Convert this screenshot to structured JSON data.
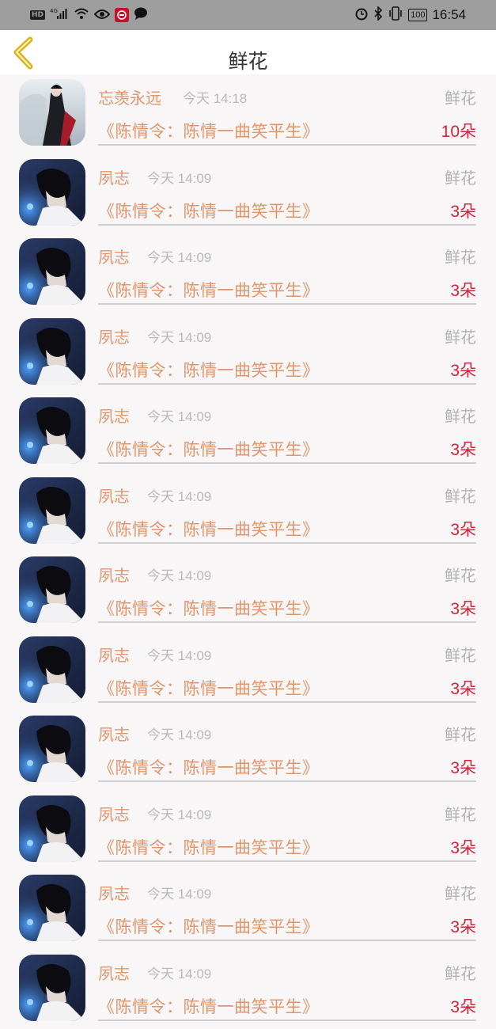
{
  "status_bar": {
    "hd": "HD",
    "signal": "4G",
    "battery": "100",
    "time": "16:54"
  },
  "header": {
    "title": "鲜花",
    "back_icon": "chevron-left-icon"
  },
  "colors": {
    "accent": "#e2956a",
    "count": "#d3223a",
    "muted": "#b9b9b9"
  },
  "records": [
    {
      "name": "忘羡永远",
      "time": "今天 14:18",
      "type": "鲜花",
      "work": "《陈情令：陈情一曲笑平生》",
      "count": "10朵"
    },
    {
      "name": "夙志",
      "time": "今天 14:09",
      "type": "鲜花",
      "work": "《陈情令：陈情一曲笑平生》",
      "count": "3朵"
    },
    {
      "name": "夙志",
      "time": "今天 14:09",
      "type": "鲜花",
      "work": "《陈情令：陈情一曲笑平生》",
      "count": "3朵"
    },
    {
      "name": "夙志",
      "time": "今天 14:09",
      "type": "鲜花",
      "work": "《陈情令：陈情一曲笑平生》",
      "count": "3朵"
    },
    {
      "name": "夙志",
      "time": "今天 14:09",
      "type": "鲜花",
      "work": "《陈情令：陈情一曲笑平生》",
      "count": "3朵"
    },
    {
      "name": "夙志",
      "time": "今天 14:09",
      "type": "鲜花",
      "work": "《陈情令：陈情一曲笑平生》",
      "count": "3朵"
    },
    {
      "name": "夙志",
      "time": "今天 14:09",
      "type": "鲜花",
      "work": "《陈情令：陈情一曲笑平生》",
      "count": "3朵"
    },
    {
      "name": "夙志",
      "time": "今天 14:09",
      "type": "鲜花",
      "work": "《陈情令：陈情一曲笑平生》",
      "count": "3朵"
    },
    {
      "name": "夙志",
      "time": "今天 14:09",
      "type": "鲜花",
      "work": "《陈情令：陈情一曲笑平生》",
      "count": "3朵"
    },
    {
      "name": "夙志",
      "time": "今天 14:09",
      "type": "鲜花",
      "work": "《陈情令：陈情一曲笑平生》",
      "count": "3朵"
    },
    {
      "name": "夙志",
      "time": "今天 14:09",
      "type": "鲜花",
      "work": "《陈情令：陈情一曲笑平生》",
      "count": "3朵"
    },
    {
      "name": "夙志",
      "time": "今天 14:09",
      "type": "鲜花",
      "work": "《陈情令：陈情一曲笑平生》",
      "count": "3朵"
    }
  ]
}
